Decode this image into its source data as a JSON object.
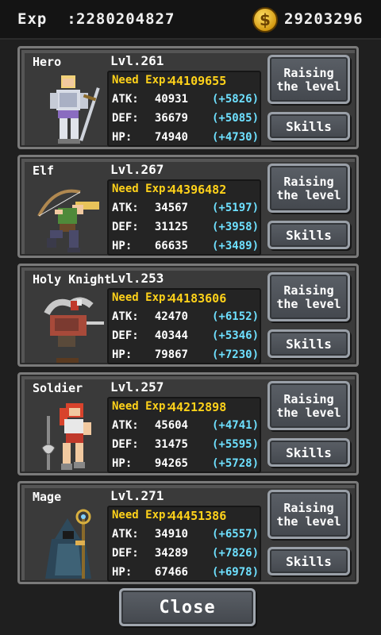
{
  "header": {
    "exp_label": "Exp  :",
    "exp_value": "2280204827",
    "coin_symbol": "$",
    "gold_value": "29203296"
  },
  "characters": [
    {
      "name": "Hero",
      "level": "Lvl.261",
      "need_exp_label": "Need Exp:",
      "need_exp": "44109655",
      "atk_label": "ATK:",
      "atk": "40931",
      "atk_bonus": "(+5826)",
      "def_label": "DEF:",
      "def": "36679",
      "def_bonus": "(+5085)",
      "hp_label": "HP:",
      "hp": "74940",
      "hp_bonus": "(+4730)",
      "raise_label_1": "Raising",
      "raise_label_2": "the level",
      "skills_label": "Skills"
    },
    {
      "name": "Elf",
      "level": "Lvl.267",
      "need_exp_label": "Need Exp:",
      "need_exp": "44396482",
      "atk_label": "ATK:",
      "atk": "34567",
      "atk_bonus": "(+5197)",
      "def_label": "DEF:",
      "def": "31125",
      "def_bonus": "(+3958)",
      "hp_label": "HP:",
      "hp": "66635",
      "hp_bonus": "(+3489)",
      "raise_label_1": "Raising",
      "raise_label_2": "the level",
      "skills_label": "Skills"
    },
    {
      "name": "Holy Knight",
      "level": "Lvl.253",
      "need_exp_label": "Need Exp:",
      "need_exp": "44183606",
      "atk_label": "ATK:",
      "atk": "42470",
      "atk_bonus": "(+6152)",
      "def_label": "DEF:",
      "def": "40344",
      "def_bonus": "(+5346)",
      "hp_label": "HP:",
      "hp": "79867",
      "hp_bonus": "(+7230)",
      "raise_label_1": "Raising",
      "raise_label_2": "the level",
      "skills_label": "Skills"
    },
    {
      "name": "Soldier",
      "level": "Lvl.257",
      "need_exp_label": "Need Exp:",
      "need_exp": "44212898",
      "atk_label": "ATK:",
      "atk": "45604",
      "atk_bonus": "(+4741)",
      "def_label": "DEF:",
      "def": "31475",
      "def_bonus": "(+5595)",
      "hp_label": "HP:",
      "hp": "94265",
      "hp_bonus": "(+5728)",
      "raise_label_1": "Raising",
      "raise_label_2": "the level",
      "skills_label": "Skills"
    },
    {
      "name": "Mage",
      "level": "Lvl.271",
      "need_exp_label": "Need Exp:",
      "need_exp": "44451386",
      "atk_label": "ATK:",
      "atk": "34910",
      "atk_bonus": "(+6557)",
      "def_label": "DEF:",
      "def": "34289",
      "def_bonus": "(+7826)",
      "hp_label": "HP:",
      "hp": "67466",
      "hp_bonus": "(+6978)",
      "raise_label_1": "Raising",
      "raise_label_2": "the level",
      "skills_label": "Skills"
    }
  ],
  "footer": {
    "close_label": "Close"
  },
  "colors": {
    "need_exp": "#ffd21a",
    "bonus": "#6ee0ff",
    "coin": "#f0b020"
  },
  "icons": {
    "coin": "gold-coin-icon"
  }
}
